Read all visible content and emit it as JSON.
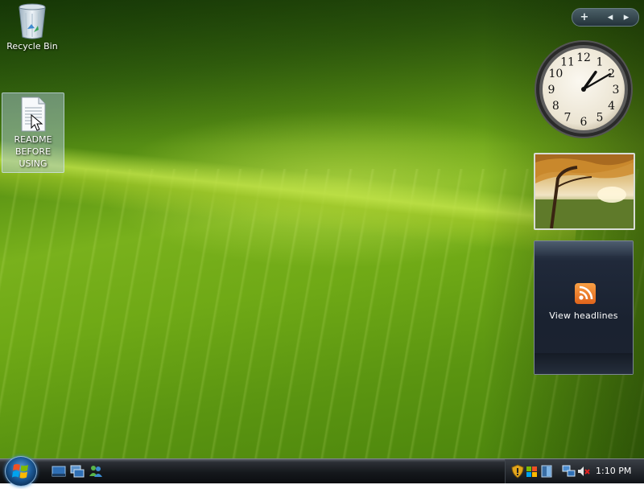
{
  "desktop": {
    "icons": [
      {
        "label": "Recycle Bin"
      },
      {
        "label": "README BEFORE USING"
      }
    ]
  },
  "sidebar": {
    "controls": {
      "add": "+",
      "prev": "◂",
      "next": "▸"
    },
    "clock": {
      "numerals": [
        "12",
        "1",
        "2",
        "3",
        "4",
        "5",
        "6",
        "7",
        "8",
        "9",
        "10",
        "11"
      ],
      "time_hours": 1,
      "time_minutes": 10
    },
    "feed": {
      "label": "View headlines"
    }
  },
  "taskbar": {
    "clock_time": "1:10 PM"
  },
  "colors": {
    "accent_orange": "#e8711f",
    "taskbar": "#15181c",
    "leaf_green": "#79b11c"
  }
}
